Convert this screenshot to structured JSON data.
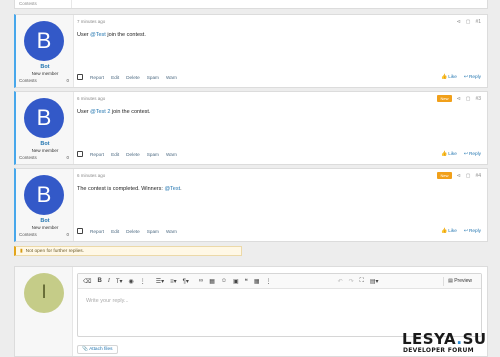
{
  "fragment": {
    "label": "Contests"
  },
  "posts": [
    {
      "author": "Bot",
      "avatar_letter": "B",
      "role": "New member",
      "stat_label": "Contests",
      "stat_value": "0",
      "time": "7 minutes ago",
      "is_new": false,
      "new_label": "",
      "number": "#1",
      "text_prefix": "User ",
      "mention": "@Test",
      "text_suffix": " join the contest."
    },
    {
      "author": "Bot",
      "avatar_letter": "B",
      "role": "New member",
      "stat_label": "Contests",
      "stat_value": "0",
      "time": "6 minutes ago",
      "is_new": true,
      "new_label": "New",
      "number": "#3",
      "text_prefix": "User ",
      "mention": "@Test 2",
      "text_suffix": " join the contest."
    },
    {
      "author": "Bot",
      "avatar_letter": "B",
      "role": "New member",
      "stat_label": "Contests",
      "stat_value": "0",
      "time": "6 minutes ago",
      "is_new": true,
      "new_label": "New",
      "number": "#4",
      "text_prefix": "The contest is completed. Winners: ",
      "mention": "@Test",
      "text_suffix": "."
    }
  ],
  "post_actions": {
    "report": "Report",
    "edit": "Edit",
    "delete": "Delete",
    "spam": "Spam",
    "warn": "Warn",
    "like": "Like",
    "reply": "Reply"
  },
  "notice": {
    "text": "Not open for further replies."
  },
  "reply_box": {
    "avatar_letter": "I",
    "placeholder": "Write your reply...",
    "preview_label": "Preview",
    "attach_label": "Attach files"
  },
  "toolbar_icons": [
    "eraser-icon",
    "bold-icon",
    "italic-icon",
    "text-size-icon",
    "palette-icon",
    "more-icon",
    "list-icon",
    "align-icon",
    "paragraph-icon",
    "link-icon",
    "image-icon",
    "emoji-icon",
    "media-icon",
    "quote-icon",
    "table-icon",
    "more-icon",
    "undo-icon",
    "redo-icon",
    "fullscreen-icon",
    "drafts-icon"
  ],
  "logo": {
    "main_a": "LESYA",
    "main_b": ".",
    "main_c": "SU",
    "sub": "DEVELOPER FORUM"
  },
  "colors": {
    "accent": "#2577b1",
    "avatar_bot": "#3359c8",
    "avatar_i": "#c5cc88",
    "new_badge": "#f1a01a"
  }
}
